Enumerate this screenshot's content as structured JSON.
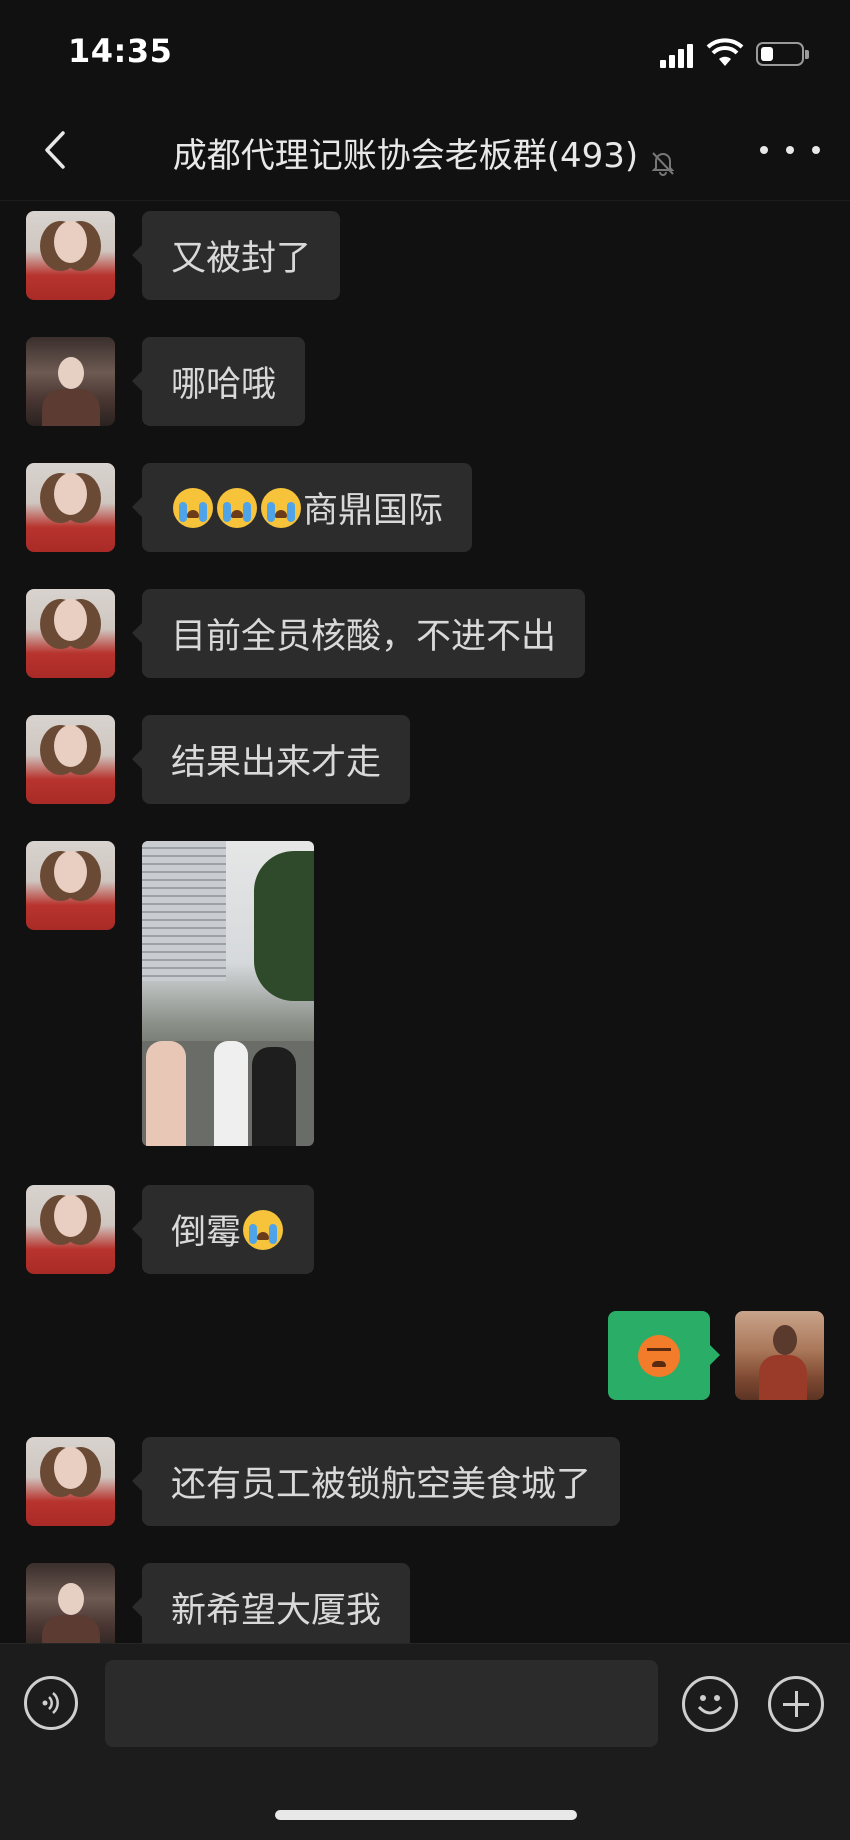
{
  "status_bar": {
    "time": "14:35"
  },
  "header": {
    "title": "成都代理记账协会老板群(493)"
  },
  "messages": [
    {
      "text": "又被封了"
    },
    {
      "text": "哪哈哦"
    },
    {
      "text": "商鼎国际"
    },
    {
      "text": "目前全员核酸，不进不出"
    },
    {
      "text": "结果出来才走"
    },
    {
      "text": "倒霉"
    },
    {
      "text": "还有员工被锁航空美食城了"
    },
    {
      "text": "新希望大厦我"
    }
  ],
  "input": {
    "value": ""
  },
  "icons": {
    "back": "chevron-left-icon",
    "mute": "bell-off-icon",
    "more": "more-dots-icon",
    "voice": "voice-icon",
    "emoji": "smiley-icon",
    "plus": "plus-icon"
  },
  "colors": {
    "background": "#111111",
    "bubble_other": "#2c2c2c",
    "bubble_self": "#2aae67"
  }
}
